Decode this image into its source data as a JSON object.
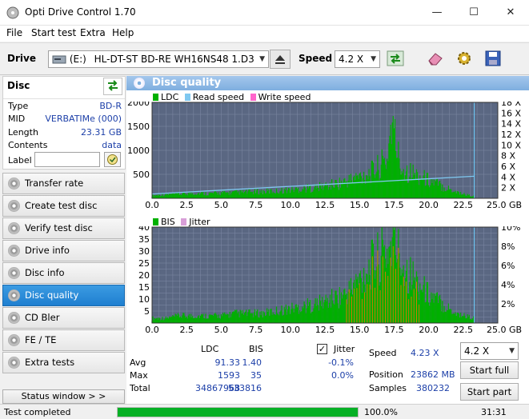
{
  "window": {
    "title": "Opti Drive Control 1.70",
    "minimize": "—",
    "maximize": "☐",
    "close": "✕"
  },
  "menu": [
    "File",
    "Start test",
    "Extra",
    "Help"
  ],
  "toolbar": {
    "drive_label": "Drive",
    "drive_letter": "(E:)",
    "drive_name": "HL-DT-ST BD-RE  WH16NS48 1.D3",
    "speed_label": "Speed",
    "speed_value": "4.2 X"
  },
  "disc": {
    "title": "Disc",
    "rows": [
      {
        "k": "Type",
        "v": "BD-R"
      },
      {
        "k": "MID",
        "v": "VERBATIMe (000)"
      },
      {
        "k": "Length",
        "v": "23.31 GB"
      },
      {
        "k": "Contents",
        "v": "data"
      }
    ],
    "label_key": "Label",
    "label_value": ""
  },
  "nav": [
    "Transfer rate",
    "Create test disc",
    "Verify test disc",
    "Drive info",
    "Disc info",
    "Disc quality",
    "CD Bler",
    "FE / TE",
    "Extra tests"
  ],
  "nav_active": "Disc quality",
  "status_window": "Status window > >",
  "panel_title": "Disc quality",
  "chart1_legend": {
    "ldc": "LDC",
    "read": "Read speed",
    "write": "Write speed"
  },
  "chart2_legend": {
    "bis": "BIS",
    "jitter": "Jitter"
  },
  "colors": {
    "ldc": "#00b000",
    "read": "#7fc8f0",
    "write": "#ff66cc",
    "bis": "#00b000",
    "jitter": "#d89fd8",
    "plotbg": "#5a6782",
    "grid": "#7f8aa5",
    "accent": "#1f7fd0"
  },
  "chart_data": [
    {
      "type": "area",
      "x_unit": "GB",
      "x_ticks": [
        "0.0",
        "2.5",
        "5.0",
        "7.5",
        "10.0",
        "12.5",
        "15.0",
        "17.5",
        "20.0",
        "22.5",
        "25.0 GB"
      ],
      "y_ticks_left": [
        "2000",
        "1500",
        "1000",
        "500"
      ],
      "y_ticks_right": [
        "18 X",
        "16 X",
        "14 X",
        "12 X",
        "10 X",
        "8 X",
        "6 X",
        "4 X",
        "2 X"
      ],
      "xlim": [
        0,
        25
      ],
      "ylim": [
        0,
        2000
      ],
      "series": [
        {
          "name": "LDC",
          "x": [
            0,
            1,
            2,
            3,
            4,
            5,
            6,
            7,
            8,
            9,
            10,
            11,
            12,
            13,
            14,
            15,
            16,
            17,
            17.3,
            17.8,
            18,
            19,
            20,
            21,
            22,
            22.5,
            23.3
          ],
          "y": [
            60,
            80,
            90,
            110,
            100,
            110,
            120,
            130,
            140,
            150,
            180,
            200,
            230,
            280,
            350,
            450,
            560,
            800,
            1593,
            900,
            650,
            500,
            380,
            250,
            140,
            90,
            40
          ]
        },
        {
          "name": "Read speed",
          "x": [
            0,
            23.3
          ],
          "y": [
            90,
            460
          ]
        }
      ]
    },
    {
      "type": "area",
      "x_unit": "GB",
      "x_ticks": [
        "0.0",
        "2.5",
        "5.0",
        "7.5",
        "10.0",
        "12.5",
        "15.0",
        "17.5",
        "20.0",
        "22.5",
        "25.0 GB"
      ],
      "y_ticks_left": [
        "40",
        "35",
        "30",
        "25",
        "20",
        "15",
        "10",
        "5"
      ],
      "y_ticks_right": [
        "10%",
        "8%",
        "6%",
        "4%",
        "2%"
      ],
      "xlim": [
        0,
        25
      ],
      "ylim": [
        0,
        40
      ],
      "series": [
        {
          "name": "BIS",
          "x": [
            0,
            1,
            2,
            3,
            4,
            5,
            6,
            7,
            8,
            9,
            10,
            11,
            12,
            13,
            14,
            15,
            16,
            17,
            17.5,
            18,
            19,
            20,
            21,
            22,
            23.3
          ],
          "y": [
            2,
            2,
            3,
            3,
            3,
            3,
            4,
            4,
            4,
            5,
            6,
            7,
            8,
            10,
            12,
            18,
            25,
            30,
            35,
            26,
            18,
            12,
            8,
            4,
            2
          ]
        }
      ]
    }
  ],
  "stats": {
    "col_ldc": "LDC",
    "col_bis": "BIS",
    "jitter_label": "Jitter",
    "jitter_checked": true,
    "rows": [
      {
        "k": "Avg",
        "ldc": "91.33",
        "bis": "1.40",
        "jit": "-0.1%"
      },
      {
        "k": "Max",
        "ldc": "1593",
        "bis": "35",
        "jit": "0.0%"
      },
      {
        "k": "Total",
        "ldc": "34867968",
        "bis": "533816",
        "jit": ""
      }
    ],
    "speed_label": "Speed",
    "speed_value": "4.23 X",
    "position_label": "Position",
    "position_value": "23862 MB",
    "samples_label": "Samples",
    "samples_value": "380232",
    "speed_combo": "4.2 X"
  },
  "buttons": {
    "start_full": "Start full",
    "start_part": "Start part"
  },
  "statusbar": {
    "text": "Test completed",
    "progress_percent": 100,
    "progress_text": "100.0%",
    "time": "31:31"
  }
}
